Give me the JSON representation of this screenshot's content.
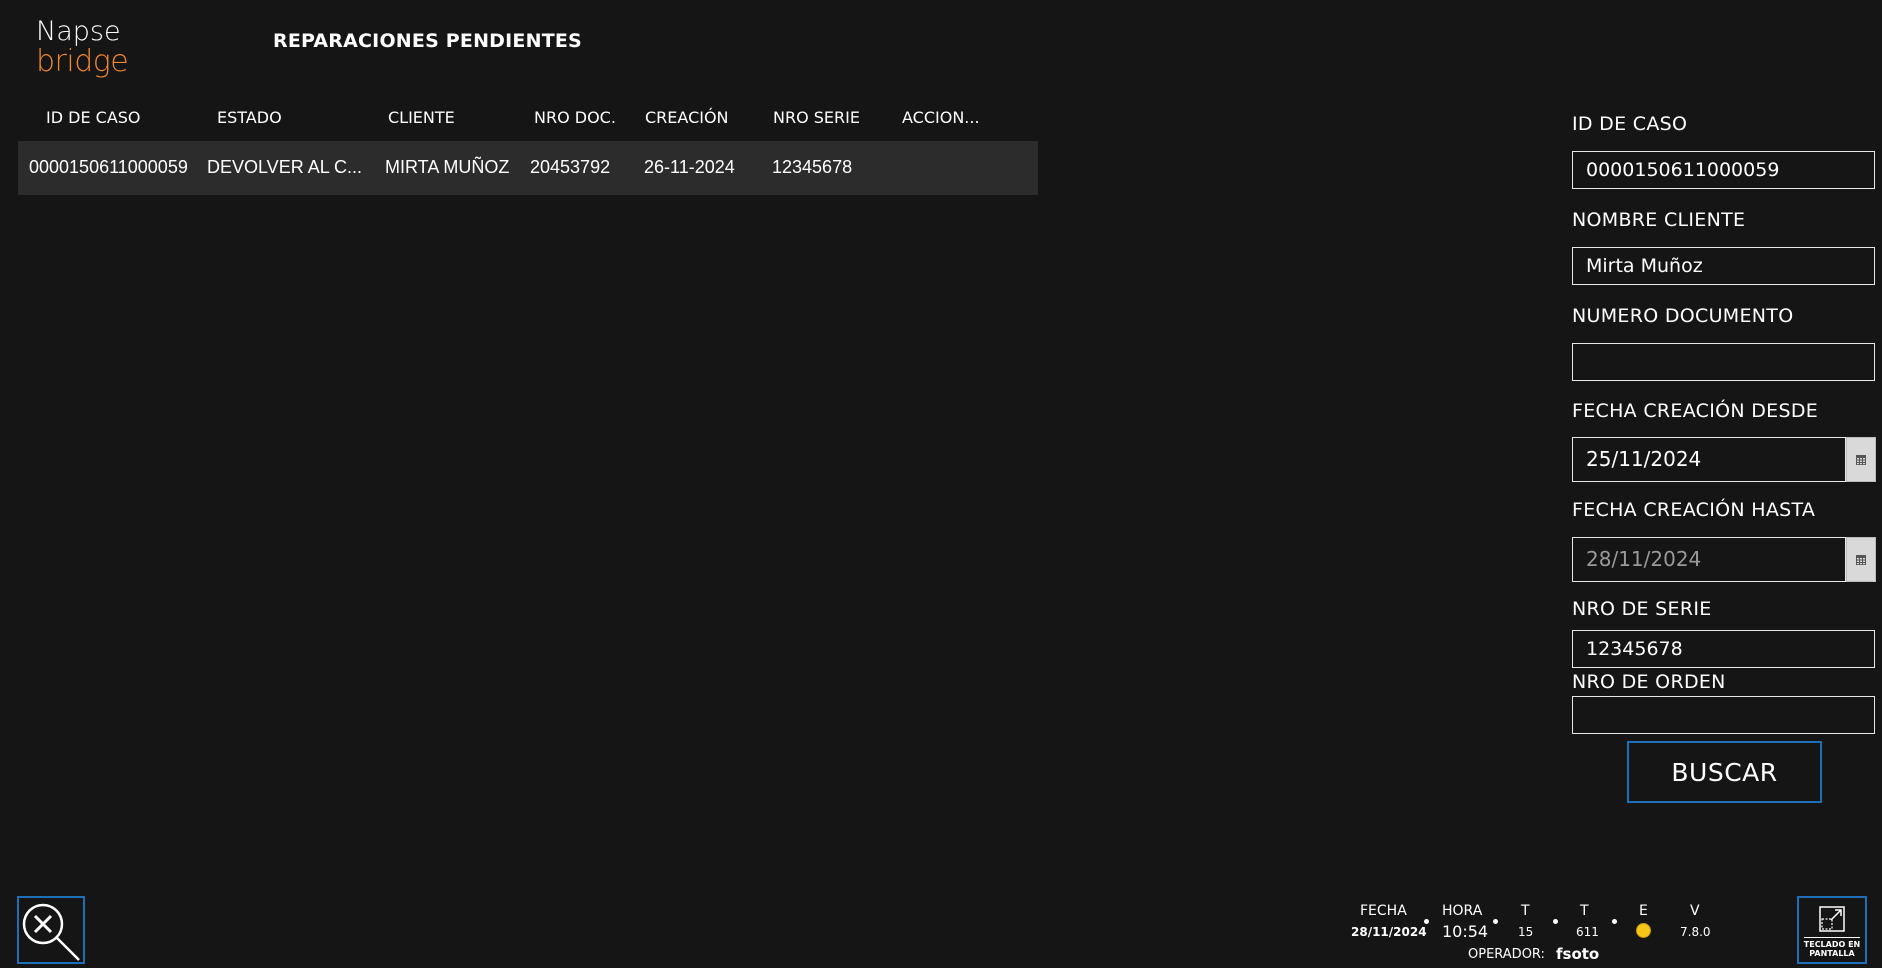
{
  "logo": {
    "line1": "Napse",
    "line2": "bridge"
  },
  "page_title": "REPARACIONES PENDIENTES",
  "table": {
    "columns": [
      "ID DE CASO",
      "ESTADO",
      "CLIENTE",
      "NRO DOC.",
      "CREACIÓN",
      "NRO SERIE",
      "ACCION..."
    ],
    "rows": [
      {
        "id": "0000150611000059",
        "estado": "DEVOLVER AL C...",
        "cliente": "MIRTA MUÑOZ",
        "doc": "20453792",
        "creacion": "26-11-2024",
        "serie": "12345678",
        "accion": ""
      }
    ]
  },
  "filters": {
    "id_caso": {
      "label": "ID DE CASO",
      "value": "0000150611000059"
    },
    "nombre_cliente": {
      "label": "NOMBRE CLIENTE",
      "value": "Mirta Muñoz"
    },
    "numero_documento": {
      "label": "NUMERO DOCUMENTO",
      "value": ""
    },
    "fecha_desde": {
      "label": "FECHA CREACIÓN DESDE",
      "value": "25/11/2024"
    },
    "fecha_hasta": {
      "label": "FECHA CREACIÓN HASTA",
      "value": "28/11/2024"
    },
    "nro_serie": {
      "label": "NRO DE SERIE",
      "value": "12345678"
    },
    "nro_orden": {
      "label": "NRO DE ORDEN",
      "value": ""
    },
    "search_button": "BUSCAR"
  },
  "status_bar": {
    "fecha_label": "FECHA",
    "fecha_value": "28/11/2024",
    "hora_label": "HORA",
    "hora_value": "10:54",
    "t1_label": "T",
    "t1_value": "15",
    "t2_label": "T",
    "t2_value": "611",
    "e_label": "E",
    "e_status_color": "#f5c518",
    "v_label": "V",
    "v_value": "7.8.0",
    "operador_label": "OPERADOR:",
    "operador_value": "fsoto"
  },
  "keyboard_button": {
    "label_line1": "TECLADO EN",
    "label_line2": "PANTALLA"
  },
  "colors": {
    "accent_border": "#1f6fb8",
    "logo_orange": "#f0862a",
    "background": "#151515",
    "row_bg": "#2c2c2c"
  }
}
